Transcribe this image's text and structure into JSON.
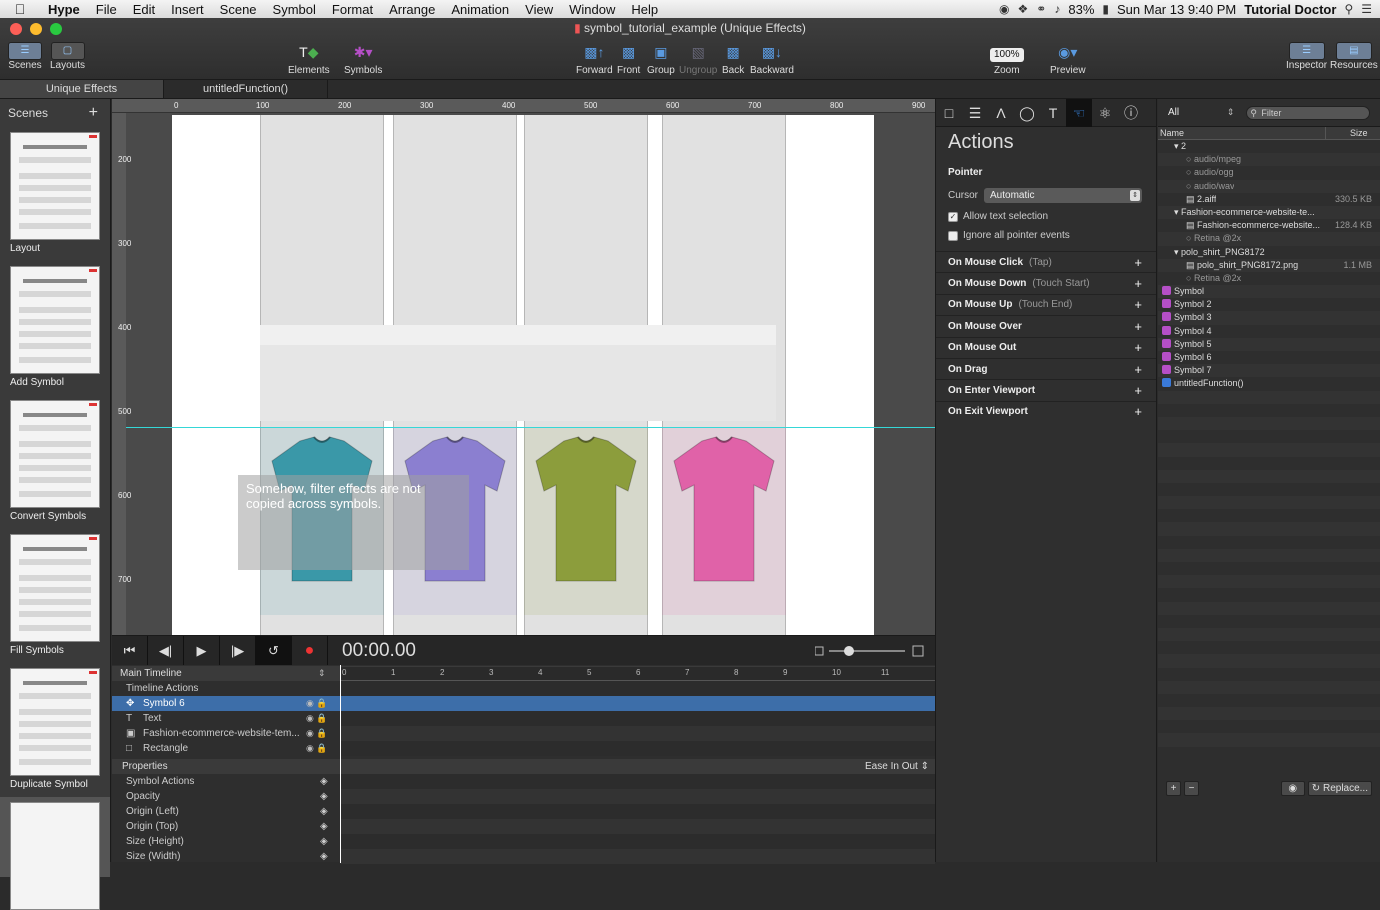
{
  "menubar": {
    "app": "Hype",
    "items": [
      "File",
      "Edit",
      "Insert",
      "Scene",
      "Symbol",
      "Format",
      "Arrange",
      "Animation",
      "View",
      "Window",
      "Help"
    ],
    "battery": "83%",
    "datetime": "Sun Mar 13  9:40 PM",
    "user": "Tutorial Doctor"
  },
  "window": {
    "title": "symbol_tutorial_example (Unique Effects)"
  },
  "toolbar": {
    "scenes": "Scenes",
    "layouts": "Layouts",
    "elements": "Elements",
    "symbols": "Symbols",
    "forward": "Forward",
    "front": "Front",
    "group": "Group",
    "ungroup": "Ungroup",
    "back": "Back",
    "backward": "Backward",
    "zoom_value": "100%",
    "zoom": "Zoom",
    "preview": "Preview",
    "inspector": "Inspector",
    "resources": "Resources"
  },
  "tabs": [
    "Unique Effects",
    "untitledFunction()"
  ],
  "scenes_panel": {
    "title": "Scenes",
    "items": [
      "Layout",
      "Add Symbol",
      "Convert Symbols",
      "Fill Symbols",
      "Duplicate Symbol"
    ]
  },
  "canvas": {
    "ruler_top": [
      "0",
      "100",
      "200",
      "300",
      "400",
      "500",
      "600",
      "700",
      "800",
      "900"
    ],
    "ruler_left": [
      "200",
      "300",
      "400",
      "500",
      "600",
      "700"
    ],
    "note": "Somehow, filter effects are not copied across symbols.",
    "shirt_colors": [
      "#3a98a8",
      "#8b7fd0",
      "#8c9d3c",
      "#e062a8"
    ]
  },
  "timeline": {
    "timecode": "00:00.00",
    "main_timeline": "Main Timeline",
    "ticks": [
      "0",
      "1",
      "2",
      "3",
      "4",
      "5",
      "6",
      "7",
      "8",
      "9",
      "10",
      "11"
    ],
    "layers": [
      "Timeline Actions",
      "Symbol 6",
      "Text",
      "Fashion-ecommerce-website-tem...",
      "Rectangle"
    ],
    "properties": "Properties",
    "easing": "Ease In Out",
    "props": [
      "Symbol Actions",
      "Opacity",
      "Origin (Left)",
      "Origin (Top)",
      "Size (Height)",
      "Size (Width)"
    ]
  },
  "inspector": {
    "title": "Actions",
    "pointer": "Pointer",
    "cursor_label": "Cursor",
    "cursor_value": "Automatic",
    "allow_text": "Allow text selection",
    "ignore_events": "Ignore all pointer events",
    "events": [
      {
        "name": "On Mouse Click",
        "sub": "(Tap)"
      },
      {
        "name": "On Mouse Down",
        "sub": "(Touch Start)"
      },
      {
        "name": "On Mouse Up",
        "sub": "(Touch End)"
      },
      {
        "name": "On Mouse Over",
        "sub": ""
      },
      {
        "name": "On Mouse Out",
        "sub": ""
      },
      {
        "name": "On Drag",
        "sub": ""
      },
      {
        "name": "On Enter Viewport",
        "sub": ""
      },
      {
        "name": "On Exit Viewport",
        "sub": ""
      }
    ]
  },
  "resources": {
    "filter_select": "All",
    "filter_placeholder": "Filter",
    "col_name": "Name",
    "col_size": "Size",
    "rows": [
      {
        "name": "2",
        "size": "",
        "indent": 1,
        "kind": "folder"
      },
      {
        "name": "audio/mpeg",
        "size": "",
        "indent": 2,
        "kind": "dim"
      },
      {
        "name": "audio/ogg",
        "size": "",
        "indent": 2,
        "kind": "dim"
      },
      {
        "name": "audio/wav",
        "size": "",
        "indent": 2,
        "kind": "dim"
      },
      {
        "name": "2.aiff",
        "size": "330.5 KB",
        "indent": 2,
        "kind": "file"
      },
      {
        "name": "Fashion-ecommerce-website-te...",
        "size": "",
        "indent": 1,
        "kind": "folder"
      },
      {
        "name": "Fashion-ecommerce-website...",
        "size": "128.4 KB",
        "indent": 2,
        "kind": "file"
      },
      {
        "name": "Retina @2x",
        "size": "",
        "indent": 2,
        "kind": "dim"
      },
      {
        "name": "polo_shirt_PNG8172",
        "size": "",
        "indent": 1,
        "kind": "folder"
      },
      {
        "name": "polo_shirt_PNG8172.png",
        "size": "1.1 MB",
        "indent": 2,
        "kind": "file"
      },
      {
        "name": "Retina @2x",
        "size": "",
        "indent": 2,
        "kind": "dim"
      },
      {
        "name": "Symbol",
        "size": "",
        "indent": 0,
        "kind": "symbol"
      },
      {
        "name": "Symbol 2",
        "size": "",
        "indent": 0,
        "kind": "symbol"
      },
      {
        "name": "Symbol 3",
        "size": "",
        "indent": 0,
        "kind": "symbol"
      },
      {
        "name": "Symbol 4",
        "size": "",
        "indent": 0,
        "kind": "symbol"
      },
      {
        "name": "Symbol 5",
        "size": "",
        "indent": 0,
        "kind": "symbol"
      },
      {
        "name": "Symbol 6",
        "size": "",
        "indent": 0,
        "kind": "symbol"
      },
      {
        "name": "Symbol 7",
        "size": "",
        "indent": 0,
        "kind": "symbol"
      },
      {
        "name": "untitledFunction()",
        "size": "",
        "indent": 0,
        "kind": "function"
      }
    ],
    "replace": "Replace..."
  }
}
